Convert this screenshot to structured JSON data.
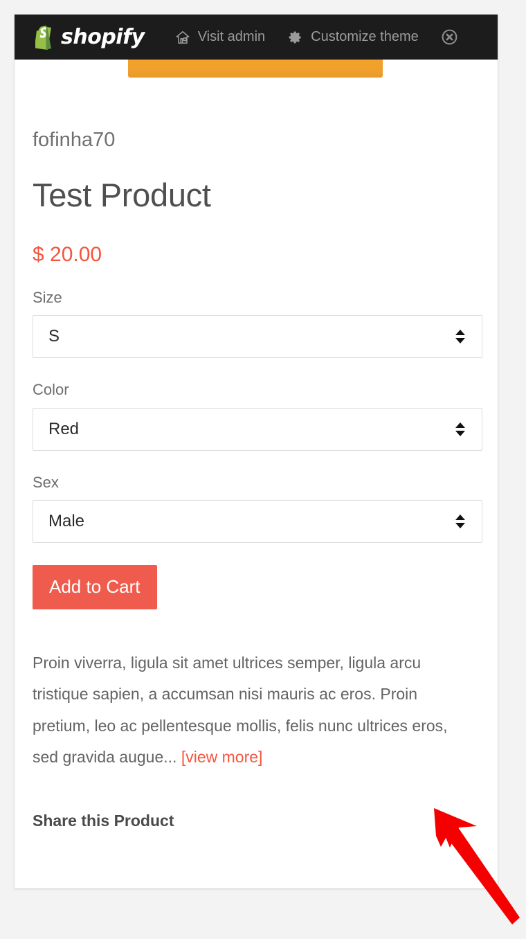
{
  "admin_bar": {
    "logo_icon": "shopify-bag-icon",
    "logo_text": "shopify",
    "visit_admin": {
      "icon": "home-icon",
      "label": "Visit admin"
    },
    "customize_theme": {
      "icon": "gear-icon",
      "label": "Customize theme"
    },
    "close": {
      "icon": "close-circle-icon",
      "label": "×"
    },
    "background_color": "#1c1c1c",
    "text_color": "#9b9b9b"
  },
  "product": {
    "image_color": "#efa02c",
    "vendor": "fofinha70",
    "title": "Test Product",
    "price": "$ 20.00",
    "price_color": "#f4553d",
    "options": [
      {
        "label": "Size",
        "value": "S"
      },
      {
        "label": "Color",
        "value": "Red"
      },
      {
        "label": "Sex",
        "value": "Male"
      }
    ],
    "add_to_cart_label": "Add to Cart",
    "add_to_cart_color": "#ef5b4c",
    "description": "Proin viverra, ligula sit amet ultrices semper, ligula arcu tristique sapien, a accumsan nisi mauris ac eros. Proin pretium, leo ac pellentesque mollis, felis nunc ultrices eros, sed gravida augue...",
    "view_more_label": "[view more]",
    "share_heading": "Share this Product"
  },
  "annotation": {
    "arrow_color": "#f40000",
    "arrow_points_to": "view-more-link"
  }
}
